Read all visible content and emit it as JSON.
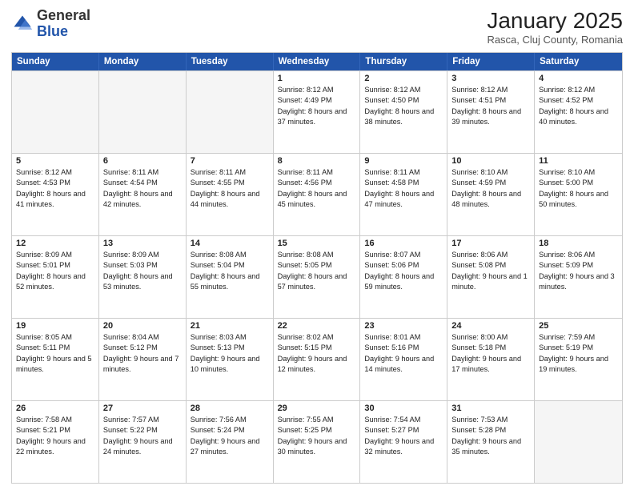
{
  "header": {
    "logo_general": "General",
    "logo_blue": "Blue",
    "month_title": "January 2025",
    "location": "Rasca, Cluj County, Romania"
  },
  "days_of_week": [
    "Sunday",
    "Monday",
    "Tuesday",
    "Wednesday",
    "Thursday",
    "Friday",
    "Saturday"
  ],
  "weeks": [
    [
      {
        "day": "",
        "empty": true
      },
      {
        "day": "",
        "empty": true
      },
      {
        "day": "",
        "empty": true
      },
      {
        "day": "1",
        "sunrise": "8:12 AM",
        "sunset": "4:49 PM",
        "daylight": "8 hours and 37 minutes."
      },
      {
        "day": "2",
        "sunrise": "8:12 AM",
        "sunset": "4:50 PM",
        "daylight": "8 hours and 38 minutes."
      },
      {
        "day": "3",
        "sunrise": "8:12 AM",
        "sunset": "4:51 PM",
        "daylight": "8 hours and 39 minutes."
      },
      {
        "day": "4",
        "sunrise": "8:12 AM",
        "sunset": "4:52 PM",
        "daylight": "8 hours and 40 minutes."
      }
    ],
    [
      {
        "day": "5",
        "sunrise": "8:12 AM",
        "sunset": "4:53 PM",
        "daylight": "8 hours and 41 minutes."
      },
      {
        "day": "6",
        "sunrise": "8:11 AM",
        "sunset": "4:54 PM",
        "daylight": "8 hours and 42 minutes."
      },
      {
        "day": "7",
        "sunrise": "8:11 AM",
        "sunset": "4:55 PM",
        "daylight": "8 hours and 44 minutes."
      },
      {
        "day": "8",
        "sunrise": "8:11 AM",
        "sunset": "4:56 PM",
        "daylight": "8 hours and 45 minutes."
      },
      {
        "day": "9",
        "sunrise": "8:11 AM",
        "sunset": "4:58 PM",
        "daylight": "8 hours and 47 minutes."
      },
      {
        "day": "10",
        "sunrise": "8:10 AM",
        "sunset": "4:59 PM",
        "daylight": "8 hours and 48 minutes."
      },
      {
        "day": "11",
        "sunrise": "8:10 AM",
        "sunset": "5:00 PM",
        "daylight": "8 hours and 50 minutes."
      }
    ],
    [
      {
        "day": "12",
        "sunrise": "8:09 AM",
        "sunset": "5:01 PM",
        "daylight": "8 hours and 52 minutes."
      },
      {
        "day": "13",
        "sunrise": "8:09 AM",
        "sunset": "5:03 PM",
        "daylight": "8 hours and 53 minutes."
      },
      {
        "day": "14",
        "sunrise": "8:08 AM",
        "sunset": "5:04 PM",
        "daylight": "8 hours and 55 minutes."
      },
      {
        "day": "15",
        "sunrise": "8:08 AM",
        "sunset": "5:05 PM",
        "daylight": "8 hours and 57 minutes."
      },
      {
        "day": "16",
        "sunrise": "8:07 AM",
        "sunset": "5:06 PM",
        "daylight": "8 hours and 59 minutes."
      },
      {
        "day": "17",
        "sunrise": "8:06 AM",
        "sunset": "5:08 PM",
        "daylight": "9 hours and 1 minute."
      },
      {
        "day": "18",
        "sunrise": "8:06 AM",
        "sunset": "5:09 PM",
        "daylight": "9 hours and 3 minutes."
      }
    ],
    [
      {
        "day": "19",
        "sunrise": "8:05 AM",
        "sunset": "5:11 PM",
        "daylight": "9 hours and 5 minutes."
      },
      {
        "day": "20",
        "sunrise": "8:04 AM",
        "sunset": "5:12 PM",
        "daylight": "9 hours and 7 minutes."
      },
      {
        "day": "21",
        "sunrise": "8:03 AM",
        "sunset": "5:13 PM",
        "daylight": "9 hours and 10 minutes."
      },
      {
        "day": "22",
        "sunrise": "8:02 AM",
        "sunset": "5:15 PM",
        "daylight": "9 hours and 12 minutes."
      },
      {
        "day": "23",
        "sunrise": "8:01 AM",
        "sunset": "5:16 PM",
        "daylight": "9 hours and 14 minutes."
      },
      {
        "day": "24",
        "sunrise": "8:00 AM",
        "sunset": "5:18 PM",
        "daylight": "9 hours and 17 minutes."
      },
      {
        "day": "25",
        "sunrise": "7:59 AM",
        "sunset": "5:19 PM",
        "daylight": "9 hours and 19 minutes."
      }
    ],
    [
      {
        "day": "26",
        "sunrise": "7:58 AM",
        "sunset": "5:21 PM",
        "daylight": "9 hours and 22 minutes."
      },
      {
        "day": "27",
        "sunrise": "7:57 AM",
        "sunset": "5:22 PM",
        "daylight": "9 hours and 24 minutes."
      },
      {
        "day": "28",
        "sunrise": "7:56 AM",
        "sunset": "5:24 PM",
        "daylight": "9 hours and 27 minutes."
      },
      {
        "day": "29",
        "sunrise": "7:55 AM",
        "sunset": "5:25 PM",
        "daylight": "9 hours and 30 minutes."
      },
      {
        "day": "30",
        "sunrise": "7:54 AM",
        "sunset": "5:27 PM",
        "daylight": "9 hours and 32 minutes."
      },
      {
        "day": "31",
        "sunrise": "7:53 AM",
        "sunset": "5:28 PM",
        "daylight": "9 hours and 35 minutes."
      },
      {
        "day": "",
        "empty": true
      }
    ]
  ]
}
